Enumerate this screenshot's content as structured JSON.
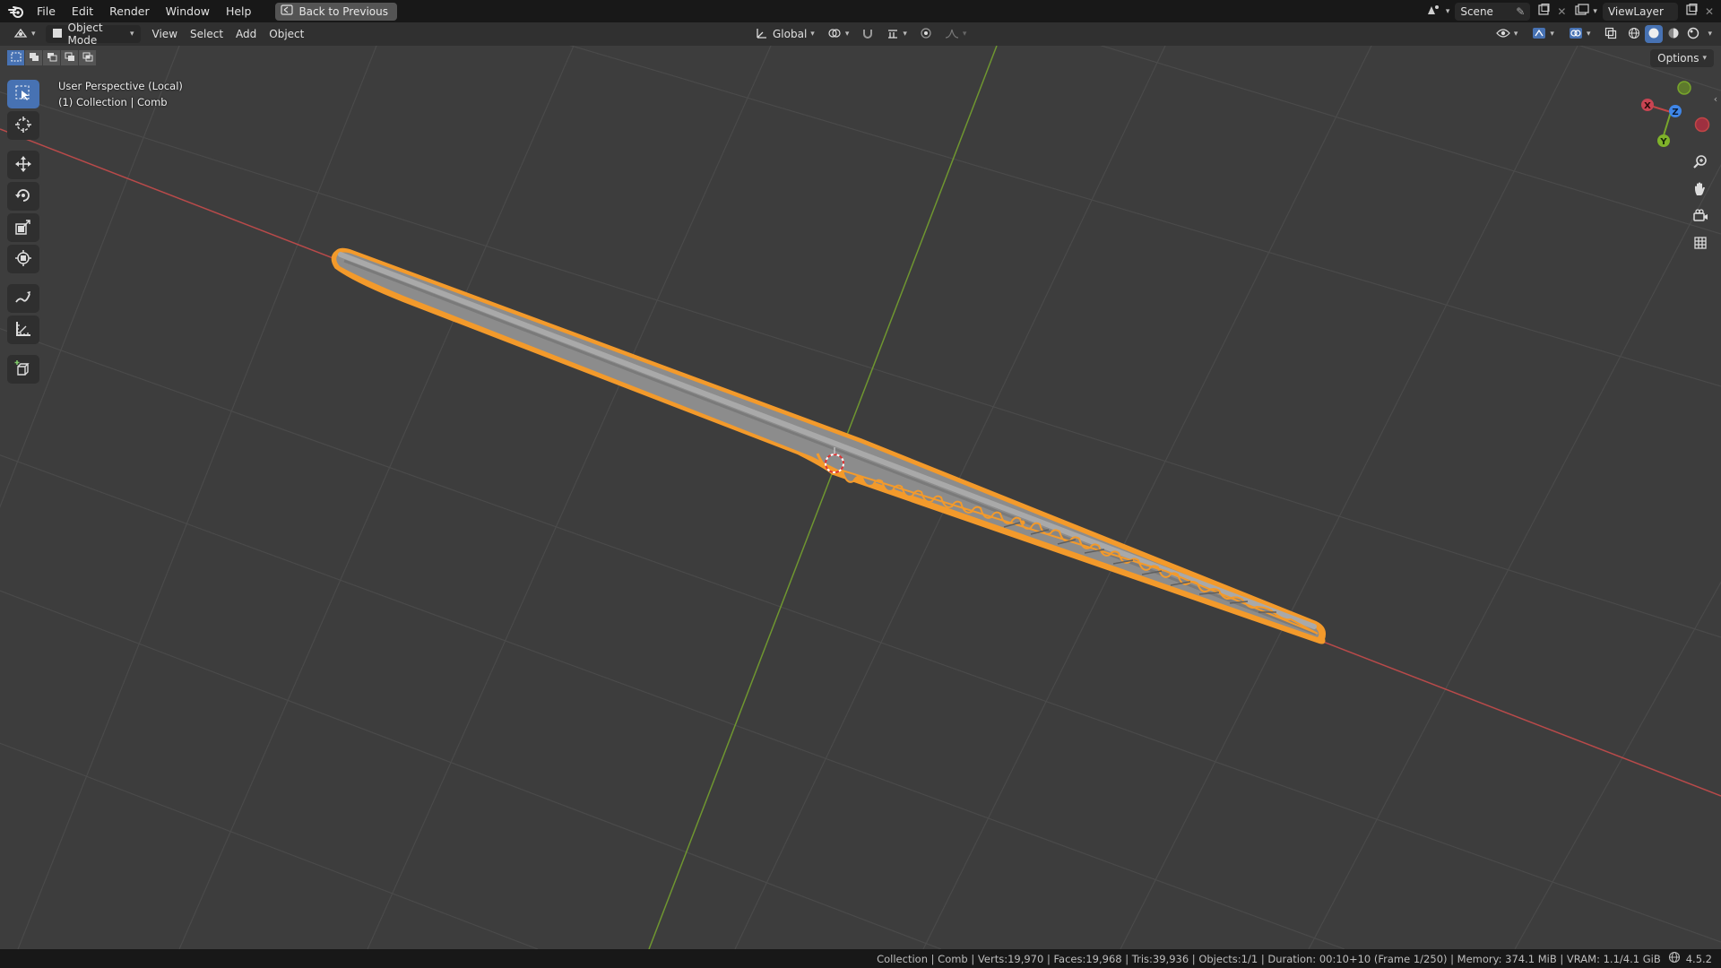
{
  "menu": {
    "items": [
      "File",
      "Edit",
      "Render",
      "Window",
      "Help"
    ],
    "back_button": "Back to Previous"
  },
  "scene": {
    "name": "Scene",
    "view_layer": "ViewLayer"
  },
  "header": {
    "mode": "Object Mode",
    "menus": [
      "View",
      "Select",
      "Add",
      "Object"
    ],
    "orientation": "Global",
    "options_label": "Options"
  },
  "viewport": {
    "perspective_label": "User Perspective (Local)",
    "collection_label": "(1) Collection | Comb",
    "gizmo_axes": {
      "x": "X",
      "y": "Y",
      "z": "Z"
    }
  },
  "toolbar": {
    "tools": [
      "select-box",
      "cursor",
      "move",
      "rotate",
      "scale",
      "transform",
      "annotate",
      "measure",
      "add-cube"
    ],
    "active": "select-box"
  },
  "status": {
    "text": "Collection | Comb | Verts:19,970 | Faces:19,968 | Tris:39,936 | Objects:1/1 | Duration: 00:10+10 (Frame 1/250) | Memory: 374.1 MiB | VRAM: 1.1/4.1 GiB",
    "version": "4.5.2"
  },
  "colors": {
    "x_axis": "#c13a3a",
    "y_axis": "#6e9a2b",
    "selection_outline": "#f39a2b",
    "active_tool": "#4772b3"
  }
}
